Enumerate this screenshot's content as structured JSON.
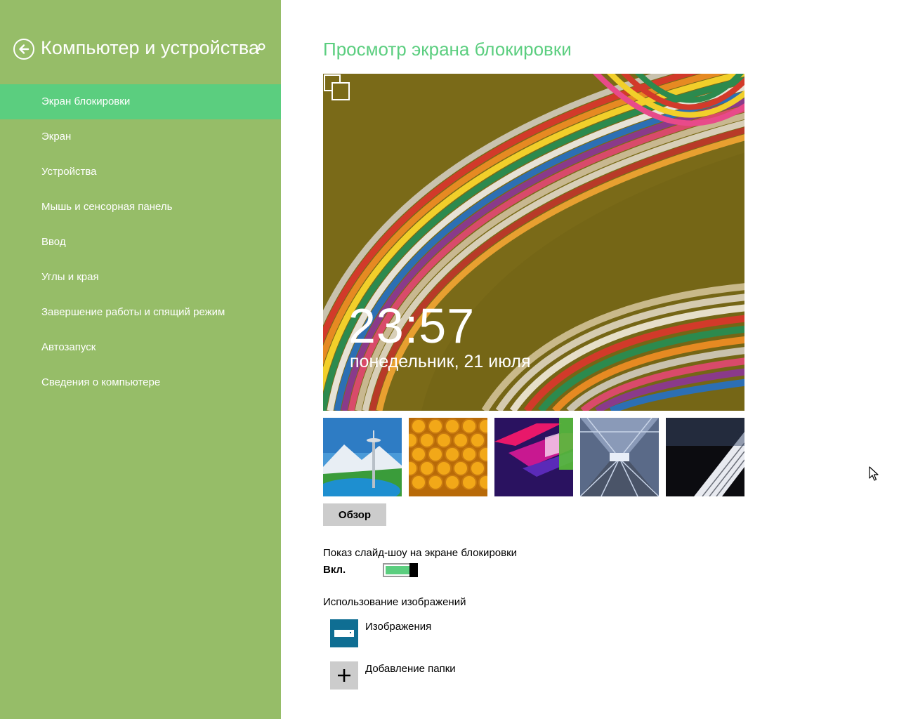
{
  "sidebar": {
    "title": "Компьютер и устройства",
    "back_icon": "back-arrow-icon",
    "search_icon": "search-icon",
    "items": [
      {
        "label": "Экран блокировки",
        "active": true
      },
      {
        "label": "Экран",
        "active": false
      },
      {
        "label": "Устройства",
        "active": false
      },
      {
        "label": "Мышь и сенсорная панель",
        "active": false
      },
      {
        "label": "Ввод",
        "active": false
      },
      {
        "label": "Углы и края",
        "active": false
      },
      {
        "label": "Завершение работы и спящий режим",
        "active": false
      },
      {
        "label": "Автозапуск",
        "active": false
      },
      {
        "label": "Сведения о компьютере",
        "active": false
      }
    ]
  },
  "main": {
    "title": "Просмотр экрана блокировки",
    "preview": {
      "time": "23:57",
      "date": "понедельник, 21 июля",
      "slideshow_icon": "slideshow-icon"
    },
    "thumbnails": [
      {
        "name": "space-needle"
      },
      {
        "name": "honeycomb"
      },
      {
        "name": "abstract-shapes"
      },
      {
        "name": "tunnel"
      },
      {
        "name": "piano-keys"
      }
    ],
    "browse_label": "Обзор",
    "slideshow": {
      "label": "Показ слайд-шоу на экране блокировки",
      "state_label": "Вкл.",
      "on": true
    },
    "images_section": {
      "label": "Использование изображений",
      "folders": [
        {
          "label": "Изображения",
          "icon": "images-folder-icon"
        },
        {
          "label": "Добавление папки",
          "icon": "add-icon"
        }
      ]
    }
  },
  "colors": {
    "sidebar_bg": "#96bd68",
    "accent": "#5bce7f",
    "folder_tile": "#0f6e93",
    "button_gray": "#cccccc"
  }
}
